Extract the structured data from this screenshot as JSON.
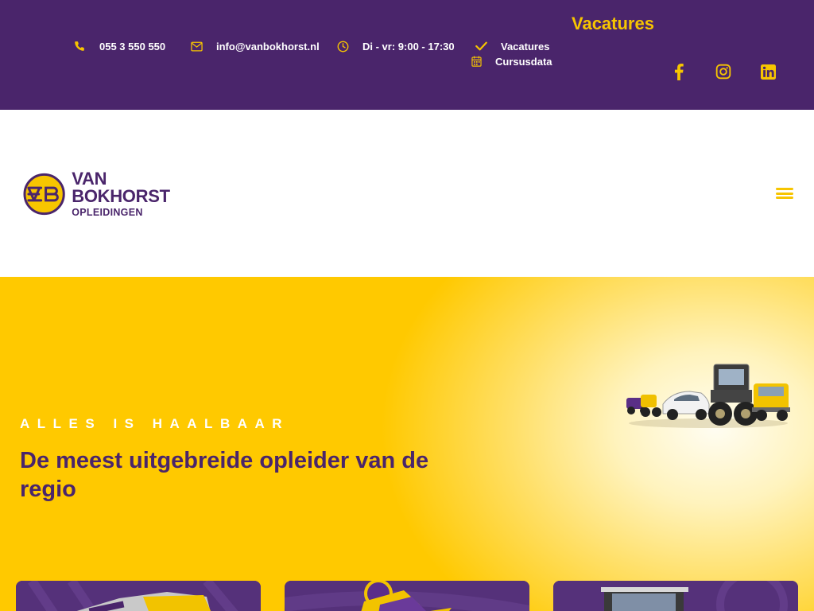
{
  "topbar": {
    "phone": "055 3 550 550",
    "email": "info@vanbokhorst.nl",
    "hours": "Di - vr: 9:00 - 17:30",
    "links": [
      "Vacatures",
      "Cursusdata"
    ],
    "vacatures_title": "Vacatures",
    "social": [
      "facebook-icon",
      "instagram-icon",
      "linkedin-icon"
    ]
  },
  "header": {
    "logo_name": "VAN BOKHORST",
    "logo_sub": "OPLEIDINGEN"
  },
  "hero": {
    "tagline": "ALLES IS HAALBAAR",
    "headline": "De meest uitgebreide opleider van de regio"
  },
  "colors": {
    "brand_purple": "#4a256b",
    "brand_yellow": "#ffc900",
    "accent_yellow": "#f7c500"
  }
}
